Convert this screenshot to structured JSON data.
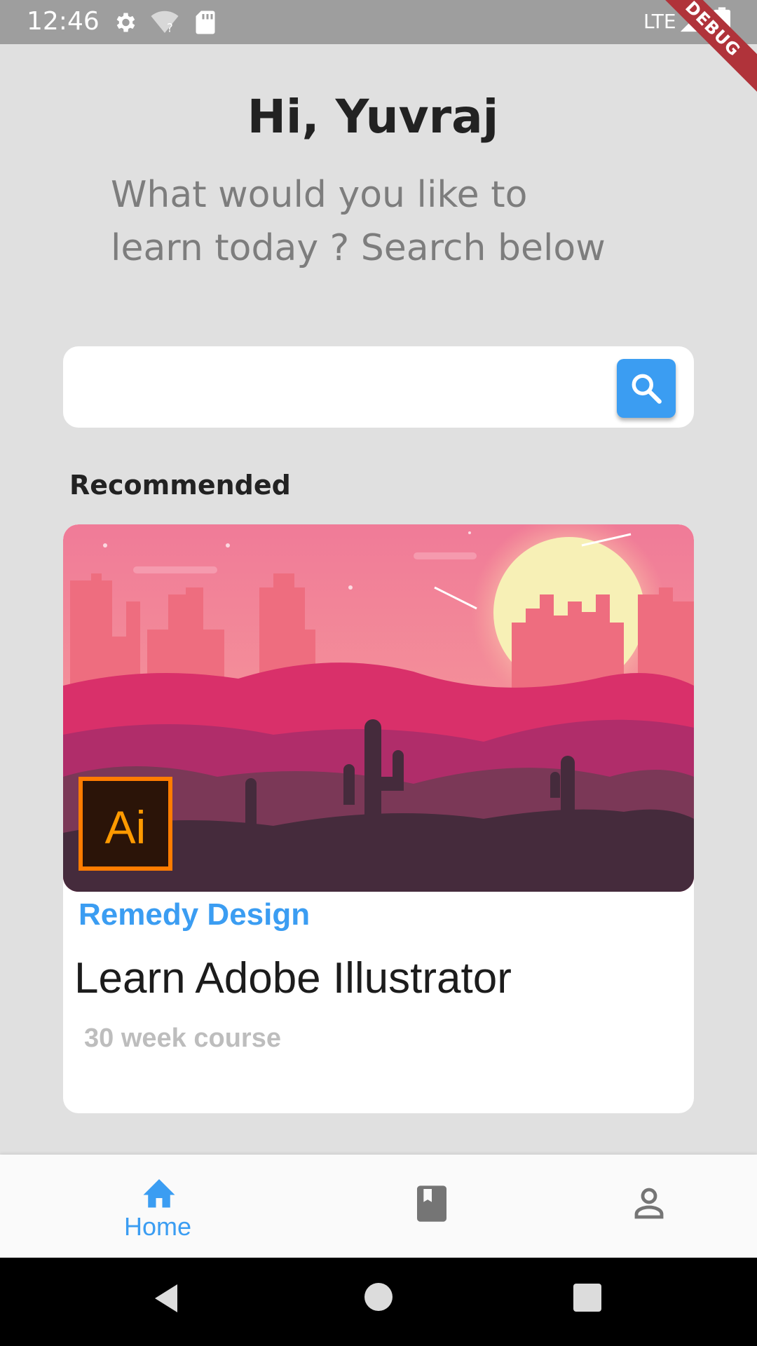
{
  "status_bar": {
    "time": "12:46",
    "network": "LTE",
    "debug_label": "DEBUG",
    "icons": [
      "settings-icon",
      "wifi-unknown-icon",
      "sd-card-icon",
      "signal-icon",
      "battery-icon"
    ]
  },
  "header": {
    "greeting": "Hi, Yuvraj",
    "subtitle": "What would you like to learn today ? Search below"
  },
  "search": {
    "value": "",
    "placeholder": "",
    "button_icon": "search-icon",
    "accent_color": "#3b9df2"
  },
  "recommended": {
    "section_title": "Recommended",
    "courses": [
      {
        "provider": "Remedy Design",
        "title": "Learn Adobe Illustrator",
        "duration": "30 week course",
        "image_badge": "Ai"
      }
    ]
  },
  "bottom_nav": {
    "items": [
      {
        "icon": "home-icon",
        "label": "Home",
        "active": true
      },
      {
        "icon": "book-icon",
        "label": "",
        "active": false
      },
      {
        "icon": "person-icon",
        "label": "",
        "active": false
      }
    ]
  },
  "system_nav": {
    "icons": [
      "back-icon",
      "home-circle-icon",
      "recents-icon"
    ]
  },
  "colors": {
    "accent": "#3b9df2",
    "background": "#e0e0e0",
    "status_bar": "#9e9e9e",
    "debug_banner": "#b0333a"
  }
}
